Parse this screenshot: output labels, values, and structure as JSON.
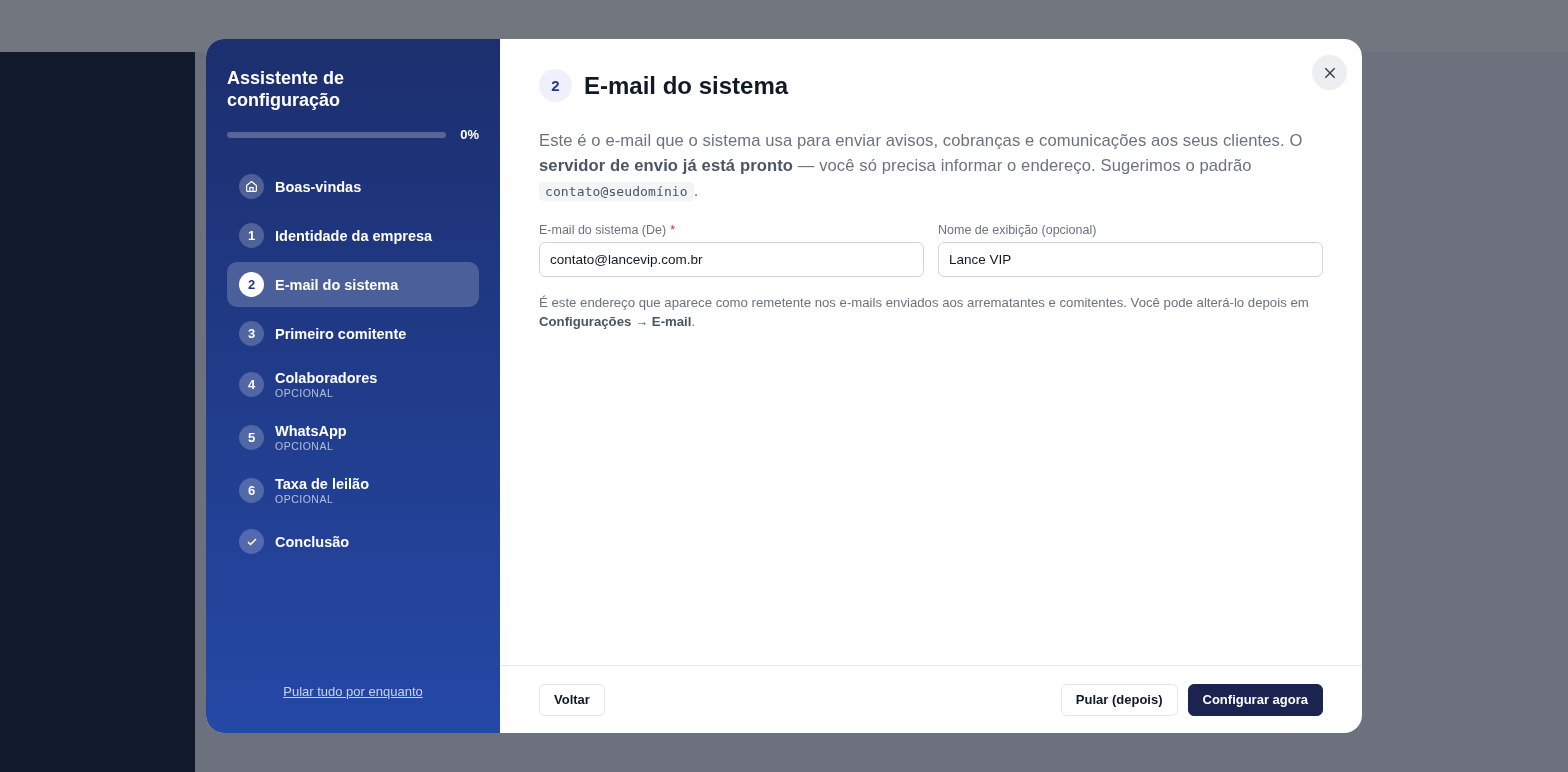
{
  "wizard": {
    "title": "Assistente de configuração",
    "progress": {
      "level": 0,
      "reading": "0%"
    },
    "steps": [
      {
        "kind": "home",
        "label": "Boas-vindas",
        "selected": false
      },
      {
        "kind": "number",
        "number": "1",
        "label": "Identidade da empresa",
        "selected": false
      },
      {
        "kind": "number",
        "number": "2",
        "label": "E-mail do sistema",
        "selected": true
      },
      {
        "kind": "number",
        "number": "3",
        "label": "Primeiro comitente",
        "selected": false
      },
      {
        "kind": "number",
        "number": "4",
        "label": "Colaboradores",
        "note": "OPCIONAL",
        "selected": false
      },
      {
        "kind": "number",
        "number": "5",
        "label": "WhatsApp",
        "note": "OPCIONAL",
        "selected": false
      },
      {
        "kind": "number",
        "number": "6",
        "label": "Taxa de leilão",
        "note": "OPCIONAL",
        "selected": false
      },
      {
        "kind": "check",
        "label": "Conclusão",
        "selected": false
      }
    ],
    "skip_all_link": "Pular tudo por enquanto"
  },
  "content": {
    "step_number": "2",
    "heading": "E-mail do sistema",
    "intro": "Este é o e-mail que o sistema usa para enviar avisos, cobranças e comunicações aos seus clientes. O **servidor de envio já está pronto** — você só precisa informar o endereço. Sugerimos o padrão",
    "suggested_address": "contato@seudomínio",
    "intro_end": ".",
    "fields": [
      {
        "label": "E-mail do sistema (De)",
        "required": true,
        "value": "contato@lancevip.com.br"
      },
      {
        "label": "Nome de exibição (opcional)",
        "required": false,
        "value": "Lance VIP"
      }
    ],
    "required_mark": "*",
    "help": "É este endereço que aparece como remetente nos e-mails enviados aos arrematantes e comitentes. Você pode alterá-lo depois em **Configurações → E-mail**."
  },
  "footer": {
    "back_button": "Voltar",
    "skip_button": "Pular (depois)",
    "primary_button": "Configurar agora"
  }
}
